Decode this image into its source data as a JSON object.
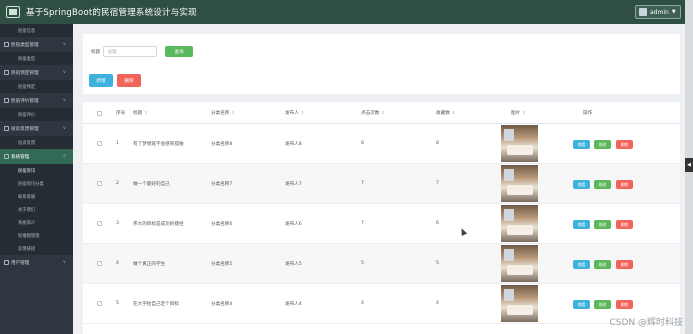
{
  "header": {
    "title": "基于SpringBoot的民宿管理系统设计与实现",
    "user": "admin"
  },
  "sidebar": {
    "items": [
      {
        "type": "sub",
        "label": "民宿信息"
      },
      {
        "type": "group",
        "label": "民宿类型管理"
      },
      {
        "type": "sub",
        "label": "民宿类型"
      },
      {
        "type": "group",
        "label": "民宿预定管理"
      },
      {
        "type": "sub",
        "label": "民宿预定"
      },
      {
        "type": "group",
        "label": "民宿评价管理"
      },
      {
        "type": "sub",
        "label": "民宿评价"
      },
      {
        "type": "group",
        "label": "投诉反馈管理"
      },
      {
        "type": "sub",
        "label": "投诉反馈"
      },
      {
        "type": "group",
        "label": "系统管理",
        "active": true
      },
      {
        "type": "sub",
        "label": "民宿资讯",
        "current": true
      },
      {
        "type": "sub",
        "label": "民宿资讯分类"
      },
      {
        "type": "sub",
        "label": "联系客服"
      },
      {
        "type": "sub",
        "label": "关于我们"
      },
      {
        "type": "sub",
        "label": "系统简介"
      },
      {
        "type": "sub",
        "label": "轮播图管理"
      },
      {
        "type": "sub",
        "label": "友情链接"
      },
      {
        "type": "group",
        "label": "用户管理"
      }
    ]
  },
  "search": {
    "label": "标题",
    "placeholder": "标题",
    "button": "查询"
  },
  "actions": {
    "add": "新增",
    "delete": "删除"
  },
  "table": {
    "headers": {
      "index": "序号",
      "title": "标题",
      "category": "分类名称",
      "publisher": "发布人",
      "clicks": "点击次数",
      "favorites": "收藏数",
      "image": "图片",
      "actions": "操作"
    },
    "rows": [
      {
        "index": "1",
        "title": "有了梦想就不会感到孤独",
        "category": "分类名称8",
        "publisher": "发布人8",
        "clicks": "8",
        "favorites": "8"
      },
      {
        "index": "2",
        "title": "做一个最好的自己",
        "category": "分类名称7",
        "publisher": "发布人7",
        "clicks": "7",
        "favorites": "7"
      },
      {
        "index": "3",
        "title": "伟大的目标是成功的捷径",
        "category": "分类名称6",
        "publisher": "发布人6",
        "clicks": "7",
        "favorites": "6"
      },
      {
        "index": "4",
        "title": "做个真正的学生",
        "category": "分类名称5",
        "publisher": "发布人5",
        "clicks": "5",
        "favorites": "5"
      },
      {
        "index": "5",
        "title": "在大学给自己定个目标",
        "category": "分类名称4",
        "publisher": "发布人4",
        "clicks": "4",
        "favorites": "4"
      }
    ],
    "row_buttons": {
      "view": "查看",
      "edit": "修改",
      "delete": "删除"
    }
  },
  "watermark": "CSDN @辉时科技"
}
